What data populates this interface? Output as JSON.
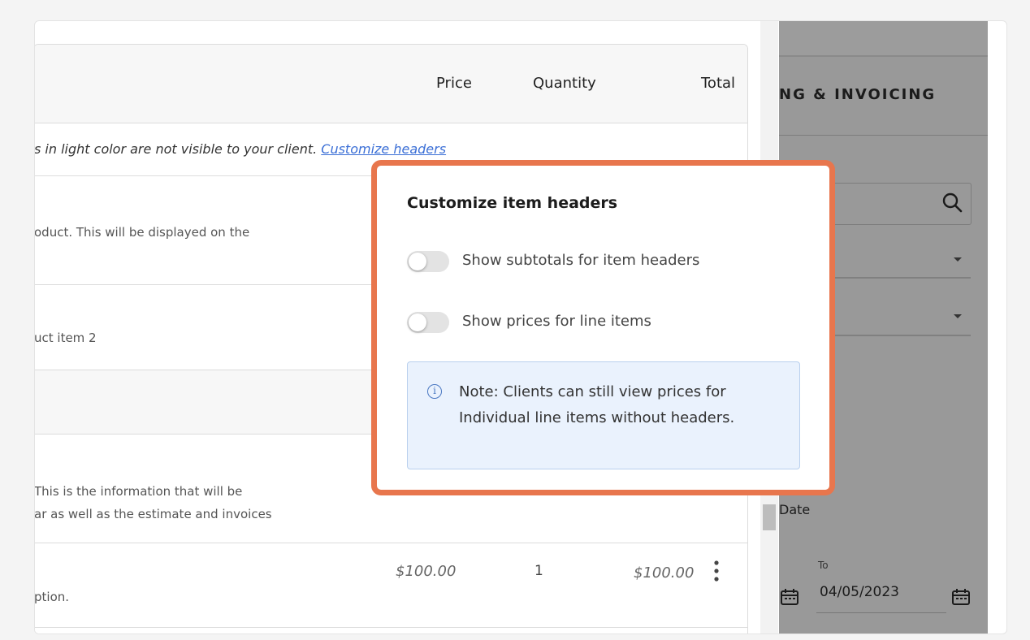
{
  "table": {
    "headers": {
      "price": "Price",
      "quantity": "Quantity",
      "total": "Total"
    },
    "hint_text": "s in light color are not visible to your client. ",
    "hint_link": "Customize headers",
    "rows": [
      {
        "desc": "oduct. This will be displayed on the"
      },
      {
        "desc": "uct item 2"
      },
      {
        "desc": ""
      },
      {
        "desc_line1": "This is the information that will be",
        "desc_line2": "ar as well as the estimate and invoices"
      },
      {
        "desc": "ption.",
        "price": "$100.00",
        "quantity": "1",
        "total": "$100.00"
      }
    ]
  },
  "sidebar": {
    "title": "NG & INVOICING",
    "date_label": "Date",
    "to_label": "To",
    "to_value": "04/05/2023"
  },
  "popup": {
    "title": "Customize item headers",
    "toggle_subtotals": "Show subtotals for item headers",
    "toggle_prices": "Show prices for line items",
    "note_icon": "i",
    "note": "Note: Clients can still view prices for Individual line items without headers."
  },
  "colors": {
    "accent_border": "#e8764d",
    "link": "#3b6fd6",
    "note_bg": "#eaf2fd",
    "overlay": "#999999"
  },
  "icons": [
    "search-icon",
    "caret-down-icon",
    "kebab-menu-icon",
    "calendar-icon",
    "info-icon"
  ]
}
